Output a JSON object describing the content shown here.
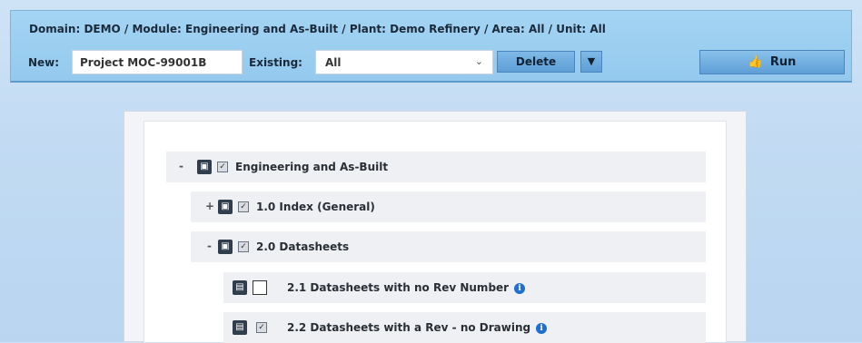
{
  "header": {
    "breadcrumb": "Domain: DEMO / Module: Engineering and As-Built / Plant: Demo Refinery / Area: All / Unit: All"
  },
  "toolbar": {
    "new_label": "New:",
    "new_value": "Project MOC-99001B",
    "existing_label": "Existing:",
    "existing_value": "All",
    "delete_label": "Delete",
    "more_glyph": "▼",
    "run_label": "Run"
  },
  "tree": {
    "root": {
      "toggle": "-",
      "label": "Engineering and As-Built",
      "checked": true
    },
    "items": [
      {
        "toggle": "+",
        "label": "1.0 Index (General)",
        "checked": true
      },
      {
        "toggle": "-",
        "label": "2.0 Datasheets",
        "checked": true
      }
    ],
    "leaves": [
      {
        "label": "2.1 Datasheets with no Rev Number",
        "checked": false
      },
      {
        "label": "2.2 Datasheets with a Rev - no Drawing",
        "checked": true
      }
    ]
  },
  "icons": {
    "info": "i",
    "check": "✓",
    "folder": "▣",
    "doc": "▤"
  },
  "colors": {
    "topbar": "#9fd0f1",
    "button": "#6aaade",
    "info": "#1e6fd0"
  }
}
